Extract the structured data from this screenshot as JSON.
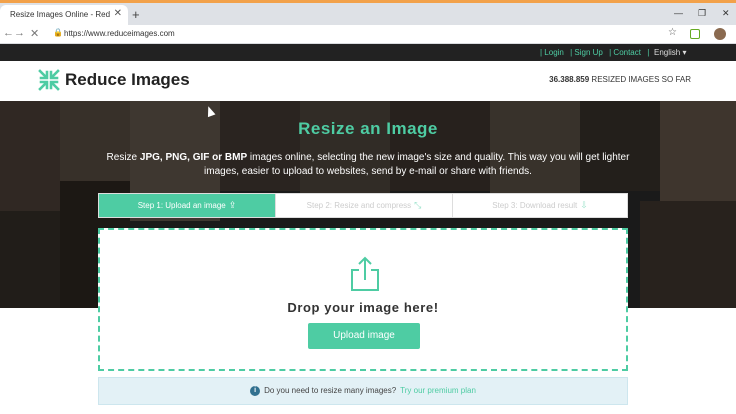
{
  "browser": {
    "tab_title": "Resize Images Online - Reduce Im",
    "tab_close": "✕",
    "new_tab": "+",
    "url": "https://www.reduceimages.com",
    "minimize": "—",
    "maximize": "❐",
    "close": "✕"
  },
  "topbar": {
    "links": [
      "| Login",
      "| Sign Up",
      "| Contact",
      "|"
    ],
    "language": "English ▾"
  },
  "header": {
    "logo_text": "Reduce Images",
    "counter_value": "36.388.859",
    "counter_label": " RESIZED IMAGES SO FAR"
  },
  "hero": {
    "title": "Resize an Image",
    "desc_prefix": "Resize ",
    "desc_formats": "JPG, PNG, GIF or BMP",
    "desc_rest": " images online, selecting the new image's size and quality. This way you will get lighter images, easier to upload to websites, send by e-mail or share with friends."
  },
  "steps": [
    {
      "label": "Step 1: Upload an image",
      "icon": "upload-icon"
    },
    {
      "label": "Step 2: Resize and compress",
      "icon": "compress-icon"
    },
    {
      "label": "Step 3: Download result",
      "icon": "download-icon"
    }
  ],
  "dropzone": {
    "text": "Drop your image here!",
    "button": "Upload image"
  },
  "premium": {
    "question": "Do you need to resize many images?",
    "link": "Try our premium plan"
  },
  "colors": {
    "accent": "#4ecca3",
    "topbar": "#222222",
    "info": "#e3f1f6"
  }
}
